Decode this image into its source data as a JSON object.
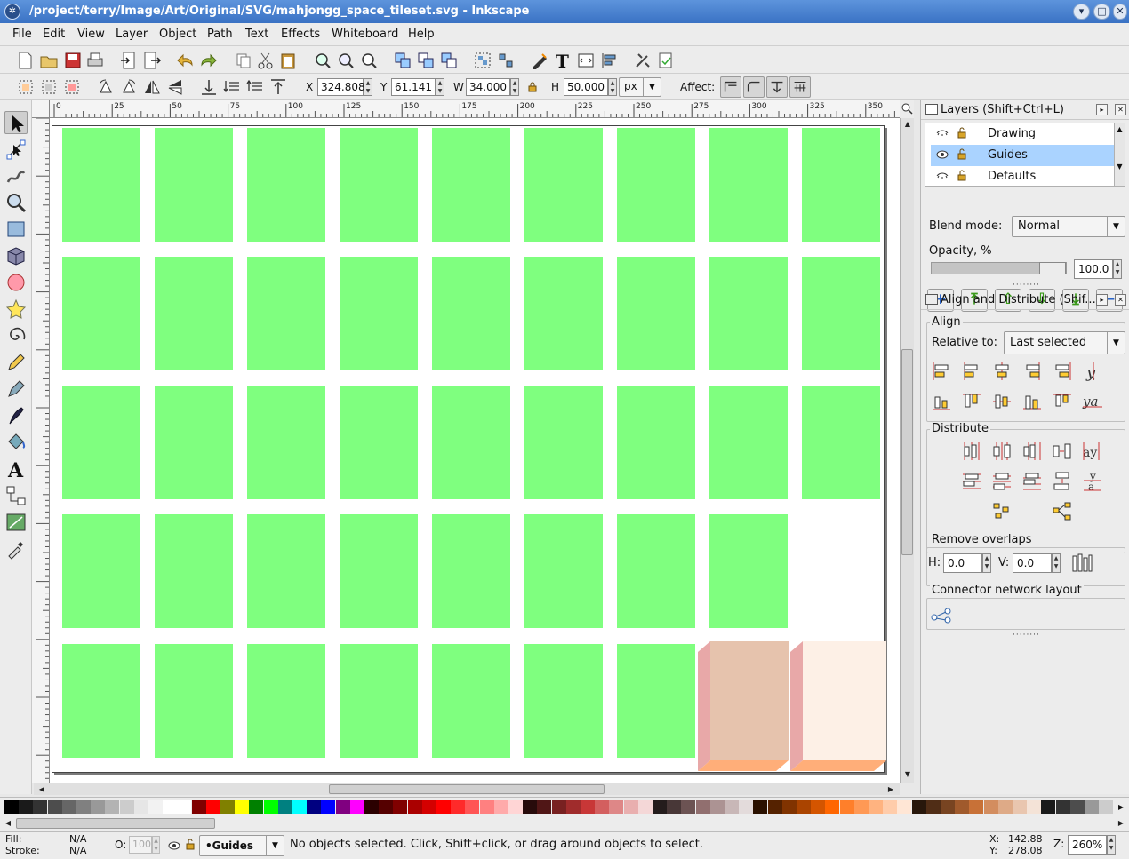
{
  "window": {
    "title": "/project/terry/Image/Art/Original/SVG/mahjongg_space_tileset.svg - Inkscape",
    "app_icon": "inkscape-icon"
  },
  "menu": [
    "File",
    "Edit",
    "View",
    "Layer",
    "Object",
    "Path",
    "Text",
    "Effects",
    "Whiteboard",
    "Help"
  ],
  "toolbar": {
    "x_label": "X",
    "x_value": "324.808",
    "y_label": "Y",
    "y_value": "61.141",
    "w_label": "W",
    "w_value": "34.000",
    "h_label": "H",
    "h_value": "50.000",
    "unit": "px",
    "affect_label": "Affect:"
  },
  "ruler": {
    "labels": [
      "0",
      "25",
      "50",
      "75",
      "100",
      "125",
      "150",
      "175",
      "200",
      "225",
      "250",
      "275",
      "300",
      "325",
      "350"
    ]
  },
  "layers_panel": {
    "title": "Layers (Shift+Ctrl+L)",
    "layers": [
      {
        "name": "Drawing",
        "selected": false
      },
      {
        "name": "Guides",
        "selected": true
      },
      {
        "name": "Defaults",
        "selected": false
      }
    ],
    "blend_label": "Blend mode:",
    "blend_value": "Normal",
    "opacity_label": "Opacity, %",
    "opacity_value": "100.0",
    "opacity_fraction": 1.0
  },
  "align_panel": {
    "title": "Align and Distribute (Shif...",
    "align_title": "Align",
    "relative_label": "Relative to:",
    "relative_value": "Last selected",
    "distribute_title": "Distribute",
    "overlaps_title": "Remove overlaps",
    "h_label": "H:",
    "h_value": "0.0",
    "v_label": "V:",
    "v_value": "0.0",
    "connector_title": "Connector network layout"
  },
  "canvas": {
    "tile_color": "#7fff7f",
    "tile_rows": [
      9,
      9,
      9,
      8,
      7
    ]
  },
  "palette": {
    "colors": [
      "#000000",
      "#1a1a1a",
      "#333333",
      "#4d4d4d",
      "#666666",
      "#808080",
      "#999999",
      "#b3b3b3",
      "#cccccc",
      "#e6e6e6",
      "#f2f2f2",
      "#ffffff",
      "#ffffff",
      "#800000",
      "#ff0000",
      "#808000",
      "#ffff00",
      "#008000",
      "#00ff00",
      "#008080",
      "#00ffff",
      "#000080",
      "#0000ff",
      "#800080",
      "#ff00ff",
      "#2b0000",
      "#550000",
      "#800000",
      "#aa0000",
      "#d40000",
      "#ff0000",
      "#ff2a2a",
      "#ff5555",
      "#ff8080",
      "#ffaaaa",
      "#ffd5d5",
      "#280b0b",
      "#501616",
      "#782121",
      "#a02c2c",
      "#c83737",
      "#d35f5f",
      "#de8787",
      "#e9afaf",
      "#f4d7d7",
      "#241c1c",
      "#483737",
      "#6c5353",
      "#916f6f",
      "#ac9393",
      "#c8b7b7",
      "#e3dbdb",
      "#2b1100",
      "#552200",
      "#803300",
      "#aa4400",
      "#d45500",
      "#ff6600",
      "#ff7f2a",
      "#ff9955",
      "#ffb380",
      "#ffccaa",
      "#ffe6d5",
      "#28170b",
      "#502d16",
      "#784421",
      "#a05a2c",
      "#c87137",
      "#d38d5f",
      "#deaa87",
      "#e9c6af",
      "#f4e3d7",
      "#1a1a1a",
      "#333333",
      "#4d4d4d",
      "#999999",
      "#cccccc"
    ]
  },
  "status": {
    "fill_label": "Fill:",
    "fill_value": "N/A",
    "stroke_label": "Stroke:",
    "stroke_value": "N/A",
    "opacity_label": "O:",
    "opacity_value": "100",
    "layer_name": "•Guides",
    "message": "No objects selected. Click, Shift+click, or drag around objects to select.",
    "x_label": "X:",
    "x_value": "142.88",
    "y_label": "Y:",
    "y_value": "278.08",
    "zoom_label": "Z:",
    "zoom_value": "260%"
  }
}
